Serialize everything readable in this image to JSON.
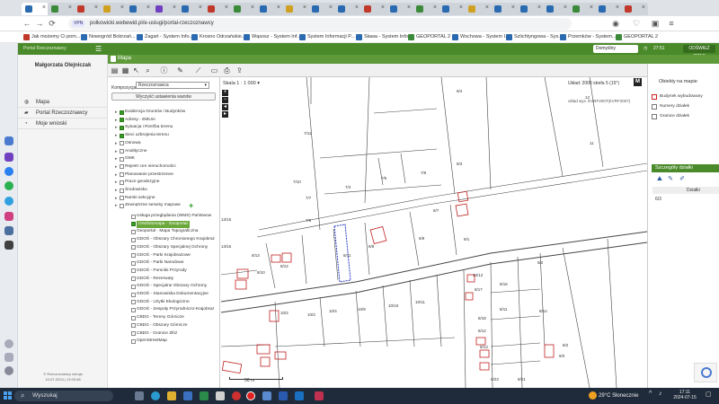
{
  "browser": {
    "url": "polkowicki.webewid.pl/e-uslugi/portal-rzeczoznawcy",
    "vpn_label": "VPN",
    "bookmarks": [
      {
        "label": "Jak możemy Ci pom...",
        "color": "#c0392b"
      },
      {
        "label": "Nowogród Bobrzań...",
        "color": "#2a6ab0"
      },
      {
        "label": "Żagań - System Info...",
        "color": "#2a6ab0"
      },
      {
        "label": "Krosno Odrzańskie...",
        "color": "#2a6ab0"
      },
      {
        "label": "Wąsosz - System Inf...",
        "color": "#2a6ab0"
      },
      {
        "label": "System Informacji P...",
        "color": "#2a6ab0"
      },
      {
        "label": "Sława - System Info...",
        "color": "#2a6ab0"
      },
      {
        "label": "GEOPORTAL 2",
        "color": "#3a8a3a"
      },
      {
        "label": "Wschowa - System I...",
        "color": "#2a6ab0"
      },
      {
        "label": "Szlichtyngowa - Sys...",
        "color": "#2a6ab0"
      },
      {
        "label": "Przemków - System...",
        "color": "#2a6ab0"
      },
      {
        "label": "GEOPORTAL 2",
        "color": "#3a8a3a"
      }
    ]
  },
  "portal": {
    "header_logo": "Portal Rzeczoznawcy",
    "domain_select": "Domyślny",
    "timer": "27:51",
    "refresh_button": "ODŚWIEŻ CZAS"
  },
  "user": {
    "name": "Małgorzata Olejniczak",
    "menu": [
      {
        "label": "Mapa",
        "icon": "globe-icon"
      },
      {
        "label": "Portal Rzeczoznawcy",
        "icon": "briefcase-icon"
      },
      {
        "label": "Moje wnioski",
        "icon": "document-icon"
      }
    ],
    "version_line1": "© Rzeczoznawcy wersja",
    "version_line2": "10-07-2024 | 13:03:48"
  },
  "map_tab": {
    "label": "Mapa"
  },
  "layers_panel": {
    "kompozycja_label": "Kompozycja:",
    "kompozycja_value": "Rzeczoznawca",
    "reset_button": "Wyczyść ustawienia warstw",
    "layers": [
      {
        "label": "Ewidencja Gruntów i Budynków",
        "checked": true
      },
      {
        "label": "Adresy - EMUiA",
        "checked": true
      },
      {
        "label": "Sytuacja i Rzeźba terenu",
        "checked": true
      },
      {
        "label": "Sieci uzbrojenia terenu",
        "checked": true
      },
      {
        "label": "Osnowa",
        "checked": false
      },
      {
        "label": "Analityczne",
        "checked": false
      },
      {
        "label": "GMK",
        "checked": false
      },
      {
        "label": "Rejestr cen nieruchomości",
        "checked": false
      },
      {
        "label": "Planowanie przestrzenne",
        "checked": false
      },
      {
        "label": "Prace geodezyjne",
        "checked": false
      },
      {
        "label": "Środowisko",
        "checked": false
      },
      {
        "label": "Ramki sekcyjne",
        "checked": false
      },
      {
        "label": "Zewnętrzne serwisy mapowe",
        "checked": false
      }
    ],
    "external_layers": [
      {
        "label": "Usługa przeglądania (WMS) Państwow",
        "checked": false,
        "highlighted": false
      },
      {
        "label": "Ortofotomapa - Geoportal",
        "checked": true,
        "highlighted": true
      },
      {
        "label": "Geoportal - Mapa Topograficzna",
        "checked": false,
        "highlighted": false
      },
      {
        "label": "GDOŚ - Obszary Chronionego Krajobraz",
        "checked": false,
        "highlighted": false
      },
      {
        "label": "GDOŚ - Obszary Specjalnej Ochrony",
        "checked": false,
        "highlighted": false
      },
      {
        "label": "GDOŚ - Parki Krajobrazowe",
        "checked": false,
        "highlighted": false
      },
      {
        "label": "GDOŚ - Parki Narodowe",
        "checked": false,
        "highlighted": false
      },
      {
        "label": "GDOŚ - Pomniki Przyrody",
        "checked": false,
        "highlighted": false
      },
      {
        "label": "GDOŚ - Rezerwaty",
        "checked": false,
        "highlighted": false
      },
      {
        "label": "GDOŚ - Specjalne Obszary Ochrony",
        "checked": false,
        "highlighted": false
      },
      {
        "label": "GDOŚ - Stanowiska Dokumentacyjne",
        "checked": false,
        "highlighted": false
      },
      {
        "label": "GDOŚ - Użytki Ekologiczne",
        "checked": false,
        "highlighted": false
      },
      {
        "label": "GDOŚ - Zespoły Przyrodniczo-Krajobraz",
        "checked": false,
        "highlighted": false
      },
      {
        "label": "CBDG - Tereny Górnicze",
        "checked": false,
        "highlighted": false
      },
      {
        "label": "CBDG - Obszary Górnicze",
        "checked": false,
        "highlighted": false
      },
      {
        "label": "CBDG - Granice Złóż",
        "checked": false,
        "highlighted": false
      },
      {
        "label": "OpenStreetMap",
        "checked": false,
        "highlighted": false
      }
    ]
  },
  "map": {
    "scale_label": "Skala",
    "scale_value": "1 : 1 000",
    "coord_system": "Układ: 2000 strefa 5 (15°)",
    "coord_system2": "układ wys. EVRF2007(EVRF2007)",
    "m_button": "M",
    "scalebar_label": "50 m",
    "parcel_labels": [
      {
        "t": "9/4"
      },
      {
        "t": "7/11"
      },
      {
        "t": "7/10"
      },
      {
        "t": "7/4"
      },
      {
        "t": "7/5"
      },
      {
        "t": "7/6"
      },
      {
        "t": "8/3"
      },
      {
        "t": "7/7"
      },
      {
        "t": "7/8"
      },
      {
        "t": "6/7"
      },
      {
        "t": "6/9"
      },
      {
        "t": "9/1"
      },
      {
        "t": "8/11"
      },
      {
        "t": "8/12"
      },
      {
        "t": "8/13"
      },
      {
        "t": "8/8"
      },
      {
        "t": "8/10"
      },
      {
        "t": "10/2"
      },
      {
        "t": "10/3"
      },
      {
        "t": "10/4"
      },
      {
        "t": "10/9"
      },
      {
        "t": "10/10"
      },
      {
        "t": "10/11"
      },
      {
        "t": "10/12"
      },
      {
        "t": "8/17"
      },
      {
        "t": "8/16"
      },
      {
        "t": "8/18"
      },
      {
        "t": "8/11"
      },
      {
        "t": "8/12"
      },
      {
        "t": "8/13"
      },
      {
        "t": "8/14"
      },
      {
        "t": "9/3"
      },
      {
        "t": "9/2"
      },
      {
        "t": "8/2"
      },
      {
        "t": "11"
      },
      {
        "t": "12"
      },
      {
        "t": "13/15"
      },
      {
        "t": "13/16"
      },
      {
        "t": "9/23"
      },
      {
        "t": "9/21"
      }
    ]
  },
  "right_panel": {
    "title": "Obiekty na mapie",
    "items": [
      {
        "label": "Budynek wybudowany",
        "color": "#d02020"
      },
      {
        "label": "Numery działek",
        "color": "none"
      },
      {
        "label": "Granice działek",
        "color": "none"
      }
    ],
    "details_title": "Szczegóły działki",
    "dzialki_header": "Działki",
    "dzialka_value": "6/3"
  },
  "taskbar": {
    "search_placeholder": "Wyszukaj",
    "weather": "29°C  Słonecznie",
    "time": "17:11",
    "date": "2024-07-15"
  }
}
